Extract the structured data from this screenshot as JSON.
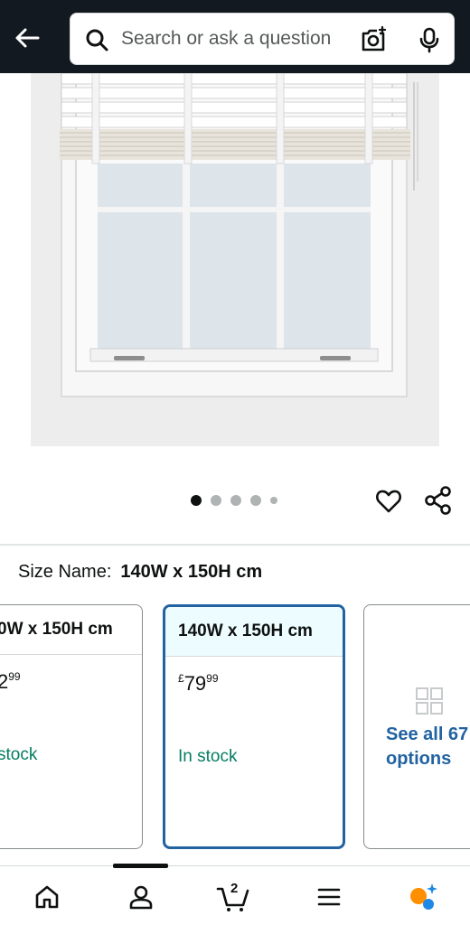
{
  "search": {
    "placeholder": "Search or ask a question"
  },
  "carousel": {
    "dot_count": 5,
    "active_index": 0
  },
  "size": {
    "label": "Size Name:",
    "selected_value": "140W x 150H cm"
  },
  "options": [
    {
      "name": "0W x 150H cm",
      "price_main": "2",
      "price_fraction": "99",
      "stock": "stock"
    },
    {
      "name": "140W x 150H cm",
      "currency": "£",
      "price_main": "79",
      "price_fraction": "99",
      "stock": "In stock",
      "selected": true
    }
  ],
  "see_all": {
    "text": "See all 67 options"
  },
  "cart": {
    "count": "2"
  },
  "colors": {
    "header_bg": "#131921",
    "link": "#2162a1",
    "in_stock": "#067d62",
    "selected_border": "#2162a1"
  }
}
